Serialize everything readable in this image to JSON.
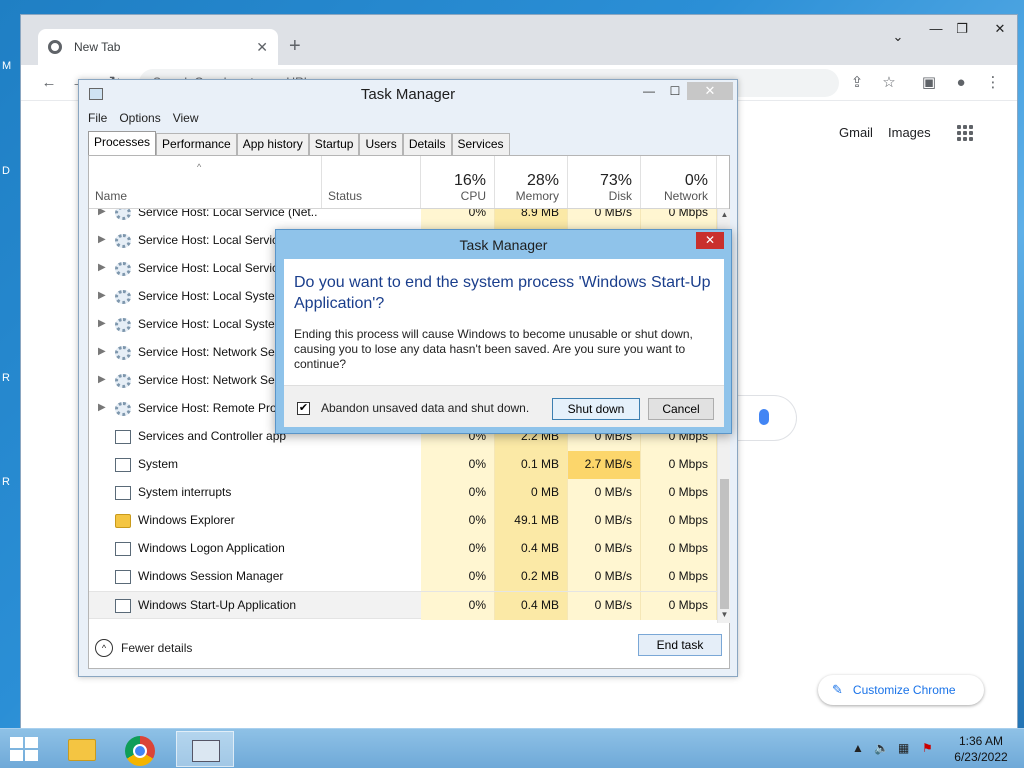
{
  "chrome": {
    "tab_title": "New Tab",
    "new_tab_symbol": "+",
    "tab_close_symbol": "✕",
    "omnibox_text": "Search Google or type a URL",
    "gmail_link": "Gmail",
    "images_link": "Images",
    "customize_label": "Customize Chrome"
  },
  "task_manager": {
    "title": "Task Manager",
    "menu": [
      "File",
      "Options",
      "View"
    ],
    "tabs": [
      "Processes",
      "Performance",
      "App history",
      "Startup",
      "Users",
      "Details",
      "Services"
    ],
    "active_tab": "Processes",
    "columns": {
      "name": "Name",
      "status": "Status",
      "cpu_pct": "16%",
      "cpu": "CPU",
      "memory_pct": "28%",
      "memory": "Memory",
      "disk_pct": "73%",
      "disk": "Disk",
      "network_pct": "0%",
      "network": "Network"
    },
    "rows": [
      {
        "name": "Service Host: Local Service (Net...",
        "cpu": "0%",
        "memory": "8.9 MB",
        "disk": "0 MB/s",
        "network": "0 Mbps",
        "expandable": true,
        "icon": "gear-icon"
      },
      {
        "name": "Service Host: Local Service",
        "cpu": "",
        "memory": "",
        "disk": "",
        "network": "",
        "expandable": true,
        "icon": "gear-icon"
      },
      {
        "name": "Service Host: Local Service",
        "cpu": "",
        "memory": "",
        "disk": "",
        "network": "",
        "expandable": true,
        "icon": "gear-icon"
      },
      {
        "name": "Service Host: Local System",
        "cpu": "",
        "memory": "",
        "disk": "",
        "network": "",
        "expandable": true,
        "icon": "gear-icon"
      },
      {
        "name": "Service Host: Local System",
        "cpu": "",
        "memory": "",
        "disk": "",
        "network": "",
        "expandable": true,
        "icon": "gear-icon"
      },
      {
        "name": "Service Host: Network Serv",
        "cpu": "",
        "memory": "",
        "disk": "",
        "network": "",
        "expandable": true,
        "icon": "gear-icon"
      },
      {
        "name": "Service Host: Network Serv",
        "cpu": "",
        "memory": "",
        "disk": "",
        "network": "",
        "expandable": true,
        "icon": "gear-icon"
      },
      {
        "name": "Service Host: Remote Proc",
        "cpu": "",
        "memory": "",
        "disk": "",
        "network": "",
        "expandable": true,
        "icon": "gear-icon"
      },
      {
        "name": "Services and Controller app",
        "cpu": "0%",
        "memory": "2.2 MB",
        "disk": "0 MB/s",
        "network": "0 Mbps",
        "expandable": false,
        "icon": "app-window-icon"
      },
      {
        "name": "System",
        "cpu": "0%",
        "memory": "0.1 MB",
        "disk": "2.7 MB/s",
        "network": "0 Mbps",
        "expandable": false,
        "icon": "app-window-icon",
        "disk_hot": true
      },
      {
        "name": "System interrupts",
        "cpu": "0%",
        "memory": "0 MB",
        "disk": "0 MB/s",
        "network": "0 Mbps",
        "expandable": false,
        "icon": "app-window-icon"
      },
      {
        "name": "Windows Explorer",
        "cpu": "0%",
        "memory": "49.1 MB",
        "disk": "0 MB/s",
        "network": "0 Mbps",
        "expandable": false,
        "icon": "folder-icon"
      },
      {
        "name": "Windows Logon Application",
        "cpu": "0%",
        "memory": "0.4 MB",
        "disk": "0 MB/s",
        "network": "0 Mbps",
        "expandable": false,
        "icon": "app-window-icon"
      },
      {
        "name": "Windows Session Manager",
        "cpu": "0%",
        "memory": "0.2 MB",
        "disk": "0 MB/s",
        "network": "0 Mbps",
        "expandable": false,
        "icon": "app-window-icon"
      },
      {
        "name": "Windows Start-Up Application",
        "cpu": "0%",
        "memory": "0.4 MB",
        "disk": "0 MB/s",
        "network": "0 Mbps",
        "expandable": false,
        "icon": "app-window-icon",
        "selected": true
      }
    ],
    "fewer_details": "Fewer details",
    "end_task": "End task"
  },
  "dialog": {
    "title": "Task Manager",
    "heading": "Do you want to end the system process 'Windows Start-Up Application'?",
    "body": "Ending this process will cause Windows to become unusable or shut down, causing you to lose any data hasn't been saved. Are you sure you want to continue?",
    "checkbox_label": "Abandon unsaved data and shut down.",
    "checkbox_checked": true,
    "shutdown_label": "Shut down",
    "cancel_label": "Cancel"
  },
  "taskbar": {
    "time": "1:36 AM",
    "date": "6/23/2022"
  },
  "desktop_letters": [
    "M",
    "D",
    "R",
    "R"
  ],
  "colors": {
    "highlight_cell": "#fcd66b",
    "dialog_border": "#8fc3ea",
    "close_red": "#c9302c"
  }
}
